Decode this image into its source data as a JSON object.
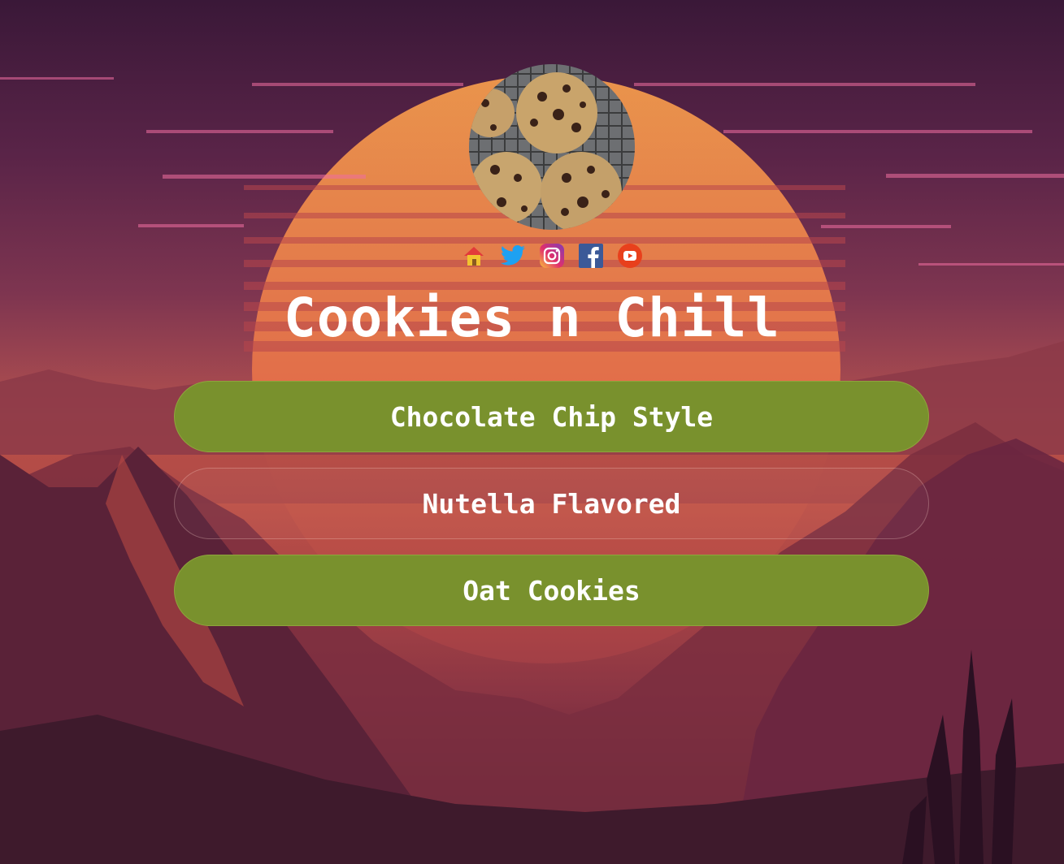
{
  "profile": {
    "title": "Cookies n Chill",
    "avatar_alt": "cookies-photo"
  },
  "socials": [
    {
      "icon": "home-icon",
      "color": "#f2c230"
    },
    {
      "icon": "twitter-icon",
      "color": "#1da1f2"
    },
    {
      "icon": "instagram-icon",
      "color": "#e1306c"
    },
    {
      "icon": "facebook-icon",
      "color": "#3b5998"
    },
    {
      "icon": "youtube-icon",
      "color": "#e8401c"
    }
  ],
  "links": [
    {
      "label": "Chocolate Chip Style",
      "style": "filled"
    },
    {
      "label": "Nutella Flavored",
      "style": "outline"
    },
    {
      "label": "Oat Cookies",
      "style": "filled"
    }
  ],
  "theme": {
    "button_green": "#79912d",
    "text_color": "#ffffff",
    "sun_color": "#e9854a"
  }
}
